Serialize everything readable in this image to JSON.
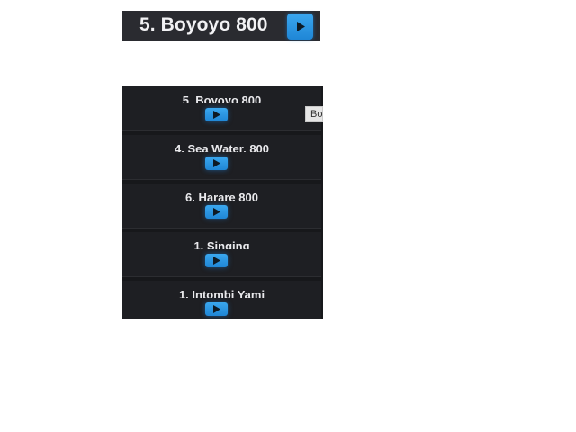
{
  "now_playing": {
    "title": "5. Boyoyo 800",
    "play_icon": "play-icon",
    "accent": "#2a95e3"
  },
  "tracks": [
    {
      "label": "5. Boyoyo 800"
    },
    {
      "label": "4. Sea Water, 800"
    },
    {
      "label": "6. Harare 800"
    },
    {
      "label": "1. Singing"
    },
    {
      "label": "1. Intombi Yami"
    }
  ],
  "tooltip": {
    "text": "Bo"
  }
}
